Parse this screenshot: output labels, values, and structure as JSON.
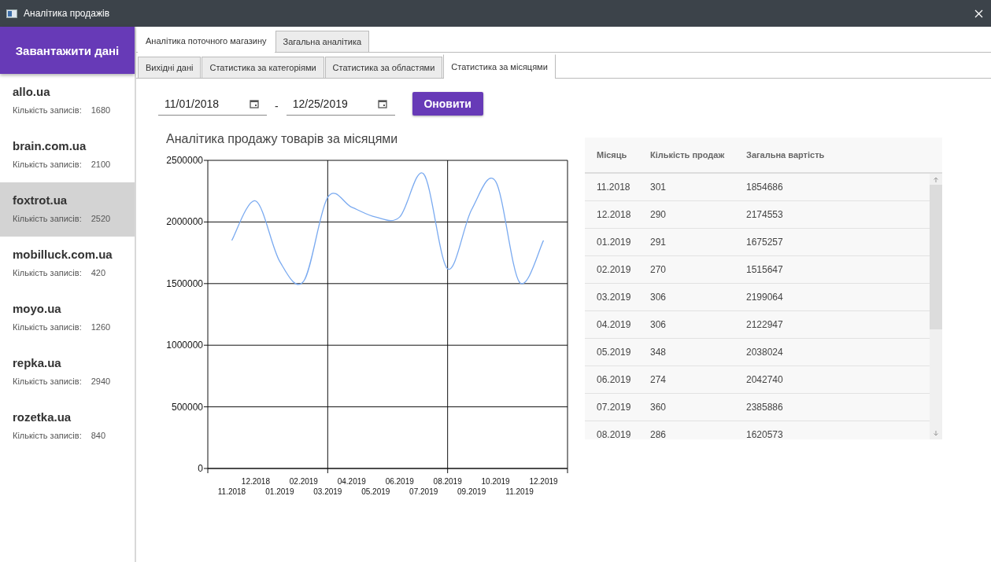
{
  "window": {
    "title": "Аналітика продажів"
  },
  "sidebar": {
    "load_button": "Завантажити дані",
    "stores": [
      {
        "name": "allo.ua",
        "count_label": "Кількість записів:",
        "count": "1680",
        "selected": false
      },
      {
        "name": "brain.com.ua",
        "count_label": "Кількість записів:",
        "count": "2100",
        "selected": false
      },
      {
        "name": "foxtrot.ua",
        "count_label": "Кількість записів:",
        "count": "2520",
        "selected": true
      },
      {
        "name": "mobilluck.com.ua",
        "count_label": "Кількість записів:",
        "count": "420",
        "selected": false
      },
      {
        "name": "moyo.ua",
        "count_label": "Кількість записів:",
        "count": "1260",
        "selected": false
      },
      {
        "name": "repka.ua",
        "count_label": "Кількість записів:",
        "count": "2940",
        "selected": false
      },
      {
        "name": "rozetka.ua",
        "count_label": "Кількість записів:",
        "count": "840",
        "selected": false
      }
    ]
  },
  "tabs": [
    {
      "label": "Аналітика поточного магазину",
      "selected": true
    },
    {
      "label": "Загальна аналітика",
      "selected": false
    }
  ],
  "subtabs": [
    {
      "label": "Вихідні дані",
      "selected": false
    },
    {
      "label": "Статистика за категоріями",
      "selected": false
    },
    {
      "label": "Статистика за областями",
      "selected": false
    },
    {
      "label": "Статистика за місяцями",
      "selected": true
    }
  ],
  "filter": {
    "date_from": "11/01/2018",
    "separator": "-",
    "date_to": "12/25/2019",
    "refresh_button": "Оновити"
  },
  "chart_data": {
    "type": "line",
    "title": "Аналітика продажу товарів за місяцями",
    "categories": [
      "11.2018",
      "12.2018",
      "01.2019",
      "02.2019",
      "03.2019",
      "04.2019",
      "05.2019",
      "06.2019",
      "07.2019",
      "08.2019",
      "09.2019",
      "10.2019",
      "11.2019",
      "12.2019"
    ],
    "series": [
      {
        "color": "#7aaaf0",
        "values": [
          1850000,
          2170000,
          1680000,
          1520000,
          2200000,
          2120000,
          2040000,
          2040000,
          2390000,
          1620000,
          2100000,
          2330000,
          1510000,
          1850000
        ]
      }
    ],
    "ylim": [
      0,
      2500000
    ],
    "yticks": [
      0,
      500000,
      1000000,
      1500000,
      2000000,
      2500000
    ],
    "grid": true
  },
  "table": {
    "columns": [
      "Місяць",
      "Кількість продаж",
      "Загальна вартість"
    ],
    "rows": [
      [
        "11.2018",
        "301",
        "1854686"
      ],
      [
        "12.2018",
        "290",
        "2174553"
      ],
      [
        "01.2019",
        "291",
        "1675257"
      ],
      [
        "02.2019",
        "270",
        "1515647"
      ],
      [
        "03.2019",
        "306",
        "2199064"
      ],
      [
        "04.2019",
        "306",
        "2122947"
      ],
      [
        "05.2019",
        "348",
        "2038024"
      ],
      [
        "06.2019",
        "274",
        "2042740"
      ],
      [
        "07.2019",
        "360",
        "2385886"
      ],
      [
        "08.2019",
        "286",
        "1620573"
      ]
    ]
  }
}
